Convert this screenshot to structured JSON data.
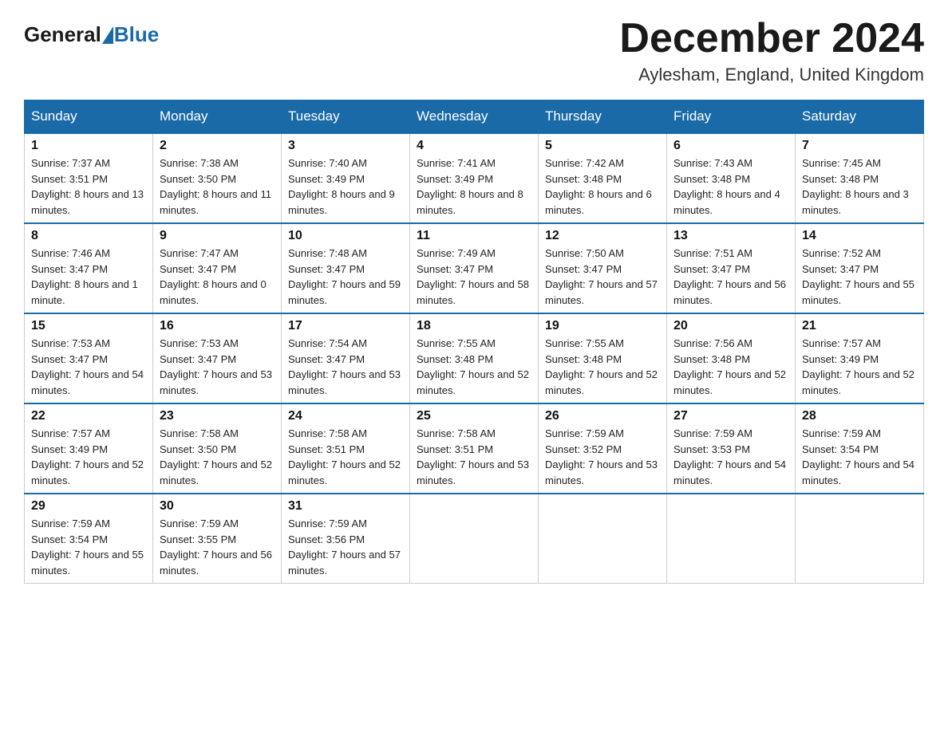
{
  "header": {
    "logo_general": "General",
    "logo_blue": "Blue",
    "month_title": "December 2024",
    "location": "Aylesham, England, United Kingdom"
  },
  "weekdays": [
    "Sunday",
    "Monday",
    "Tuesday",
    "Wednesday",
    "Thursday",
    "Friday",
    "Saturday"
  ],
  "weeks": [
    [
      {
        "day": "1",
        "sunrise": "7:37 AM",
        "sunset": "3:51 PM",
        "daylight": "8 hours and 13 minutes."
      },
      {
        "day": "2",
        "sunrise": "7:38 AM",
        "sunset": "3:50 PM",
        "daylight": "8 hours and 11 minutes."
      },
      {
        "day": "3",
        "sunrise": "7:40 AM",
        "sunset": "3:49 PM",
        "daylight": "8 hours and 9 minutes."
      },
      {
        "day": "4",
        "sunrise": "7:41 AM",
        "sunset": "3:49 PM",
        "daylight": "8 hours and 8 minutes."
      },
      {
        "day": "5",
        "sunrise": "7:42 AM",
        "sunset": "3:48 PM",
        "daylight": "8 hours and 6 minutes."
      },
      {
        "day": "6",
        "sunrise": "7:43 AM",
        "sunset": "3:48 PM",
        "daylight": "8 hours and 4 minutes."
      },
      {
        "day": "7",
        "sunrise": "7:45 AM",
        "sunset": "3:48 PM",
        "daylight": "8 hours and 3 minutes."
      }
    ],
    [
      {
        "day": "8",
        "sunrise": "7:46 AM",
        "sunset": "3:47 PM",
        "daylight": "8 hours and 1 minute."
      },
      {
        "day": "9",
        "sunrise": "7:47 AM",
        "sunset": "3:47 PM",
        "daylight": "8 hours and 0 minutes."
      },
      {
        "day": "10",
        "sunrise": "7:48 AM",
        "sunset": "3:47 PM",
        "daylight": "7 hours and 59 minutes."
      },
      {
        "day": "11",
        "sunrise": "7:49 AM",
        "sunset": "3:47 PM",
        "daylight": "7 hours and 58 minutes."
      },
      {
        "day": "12",
        "sunrise": "7:50 AM",
        "sunset": "3:47 PM",
        "daylight": "7 hours and 57 minutes."
      },
      {
        "day": "13",
        "sunrise": "7:51 AM",
        "sunset": "3:47 PM",
        "daylight": "7 hours and 56 minutes."
      },
      {
        "day": "14",
        "sunrise": "7:52 AM",
        "sunset": "3:47 PM",
        "daylight": "7 hours and 55 minutes."
      }
    ],
    [
      {
        "day": "15",
        "sunrise": "7:53 AM",
        "sunset": "3:47 PM",
        "daylight": "7 hours and 54 minutes."
      },
      {
        "day": "16",
        "sunrise": "7:53 AM",
        "sunset": "3:47 PM",
        "daylight": "7 hours and 53 minutes."
      },
      {
        "day": "17",
        "sunrise": "7:54 AM",
        "sunset": "3:47 PM",
        "daylight": "7 hours and 53 minutes."
      },
      {
        "day": "18",
        "sunrise": "7:55 AM",
        "sunset": "3:48 PM",
        "daylight": "7 hours and 52 minutes."
      },
      {
        "day": "19",
        "sunrise": "7:55 AM",
        "sunset": "3:48 PM",
        "daylight": "7 hours and 52 minutes."
      },
      {
        "day": "20",
        "sunrise": "7:56 AM",
        "sunset": "3:48 PM",
        "daylight": "7 hours and 52 minutes."
      },
      {
        "day": "21",
        "sunrise": "7:57 AM",
        "sunset": "3:49 PM",
        "daylight": "7 hours and 52 minutes."
      }
    ],
    [
      {
        "day": "22",
        "sunrise": "7:57 AM",
        "sunset": "3:49 PM",
        "daylight": "7 hours and 52 minutes."
      },
      {
        "day": "23",
        "sunrise": "7:58 AM",
        "sunset": "3:50 PM",
        "daylight": "7 hours and 52 minutes."
      },
      {
        "day": "24",
        "sunrise": "7:58 AM",
        "sunset": "3:51 PM",
        "daylight": "7 hours and 52 minutes."
      },
      {
        "day": "25",
        "sunrise": "7:58 AM",
        "sunset": "3:51 PM",
        "daylight": "7 hours and 53 minutes."
      },
      {
        "day": "26",
        "sunrise": "7:59 AM",
        "sunset": "3:52 PM",
        "daylight": "7 hours and 53 minutes."
      },
      {
        "day": "27",
        "sunrise": "7:59 AM",
        "sunset": "3:53 PM",
        "daylight": "7 hours and 54 minutes."
      },
      {
        "day": "28",
        "sunrise": "7:59 AM",
        "sunset": "3:54 PM",
        "daylight": "7 hours and 54 minutes."
      }
    ],
    [
      {
        "day": "29",
        "sunrise": "7:59 AM",
        "sunset": "3:54 PM",
        "daylight": "7 hours and 55 minutes."
      },
      {
        "day": "30",
        "sunrise": "7:59 AM",
        "sunset": "3:55 PM",
        "daylight": "7 hours and 56 minutes."
      },
      {
        "day": "31",
        "sunrise": "7:59 AM",
        "sunset": "3:56 PM",
        "daylight": "7 hours and 57 minutes."
      },
      null,
      null,
      null,
      null
    ]
  ],
  "labels": {
    "sunrise": "Sunrise:",
    "sunset": "Sunset:",
    "daylight": "Daylight:"
  }
}
